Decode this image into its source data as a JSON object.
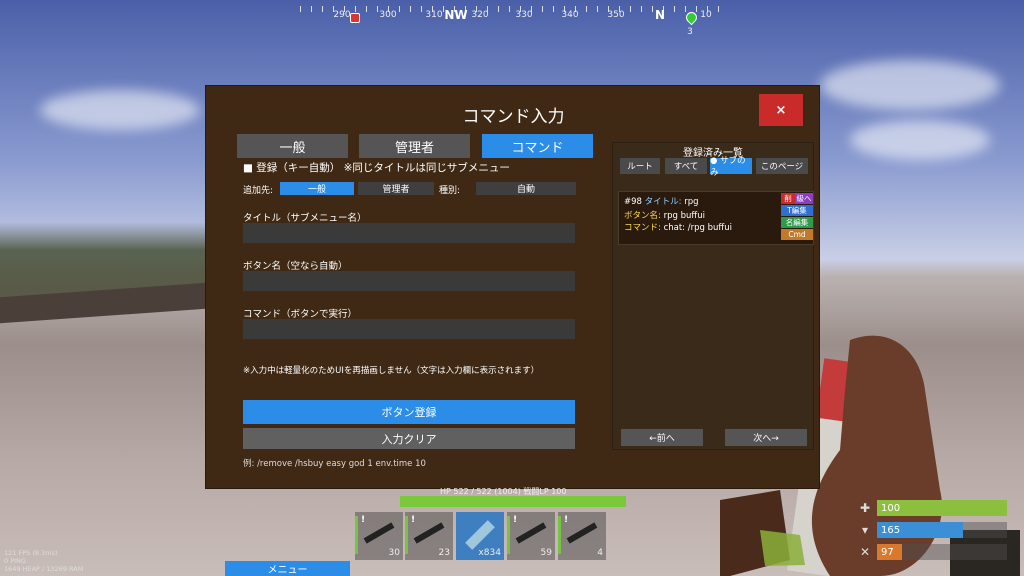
{
  "compass": {
    "labels": [
      {
        "text": "290",
        "pos": 42
      },
      {
        "text": "300",
        "pos": 88
      },
      {
        "text": "310",
        "pos": 134
      },
      {
        "text": "NW",
        "pos": 156,
        "major": true
      },
      {
        "text": "320",
        "pos": 180
      },
      {
        "text": "330",
        "pos": 224
      },
      {
        "text": "340",
        "pos": 270
      },
      {
        "text": "350",
        "pos": 316
      },
      {
        "text": "N",
        "pos": 360,
        "major": true
      },
      {
        "text": "10",
        "pos": 406
      }
    ],
    "marker_count": "3"
  },
  "dialog": {
    "title": "コマンド入力",
    "close_label": "×",
    "tabs": [
      {
        "label": "一般",
        "active": false
      },
      {
        "label": "管理者",
        "active": false
      },
      {
        "label": "コマンド",
        "active": true
      }
    ],
    "register_heading": "■ 登録（キー自動）  ※同じタイトルは同じサブメニュー",
    "target_label": "追加先:",
    "target_options": [
      {
        "label": "一般",
        "active": true
      },
      {
        "label": "管理者",
        "active": false
      }
    ],
    "type_label": "種別:",
    "type_value": "自動",
    "title_field_label": "タイトル（サブメニュー名）",
    "title_field_value": "",
    "button_field_label": "ボタン名（空なら自動）",
    "button_field_value": "",
    "command_field_label": "コマンド（ボタンで実行）",
    "command_field_value": "",
    "note": "※入力中は軽量化のためUIを再描画しません（文字は入力欄に表示されます）",
    "register_button": "ボタン登録",
    "clear_button": "入力クリア",
    "example": "例: /remove  /hsbuy easy  god 1  env.time 10"
  },
  "registered": {
    "title": "登録済み一覧",
    "filters": [
      {
        "label": "ルート",
        "active": false
      },
      {
        "label": "すべて",
        "active": false
      },
      {
        "label": "● サブのみ",
        "active": true
      },
      {
        "label": "このページ",
        "active": false
      }
    ],
    "entries": [
      {
        "id": "#98",
        "title_key": "タイトル:",
        "title_val": "rpg",
        "button_key": "ボタン名:",
        "button_val": "rpg buffui",
        "command_key": "コマンド:",
        "command_val": "chat: /rpg buffui",
        "actions": [
          "削",
          "級へ",
          "T編集",
          "名編集",
          "Cmd"
        ]
      }
    ],
    "prev_label": "←前へ",
    "next_label": "次へ→"
  },
  "hud": {
    "hp_text": "HP 522 / 522 (1004) 戦闘LP 100",
    "hp_fraction": 1.0,
    "hotbar": [
      {
        "count": "30",
        "selected": false
      },
      {
        "count": "23",
        "selected": false
      },
      {
        "count": "x834",
        "selected": true
      },
      {
        "count": "59",
        "selected": false
      },
      {
        "count": "4",
        "selected": false
      }
    ],
    "stats": [
      {
        "icon": "health-icon",
        "glyph": "✚",
        "value": "100",
        "color": "#8dbf3f",
        "fraction": 1.0
      },
      {
        "icon": "water-icon",
        "glyph": "▾",
        "value": "165",
        "color": "#3a8fd6",
        "fraction": 0.66
      },
      {
        "icon": "food-icon",
        "glyph": "✕",
        "value": "97",
        "color": "#d8792e",
        "fraction": 0.19
      }
    ],
    "perf": [
      "121 FPS (8.3ms)",
      "0 PING",
      "1649 HEAP / 13269 RAM"
    ],
    "menu_label": "メニュー"
  }
}
